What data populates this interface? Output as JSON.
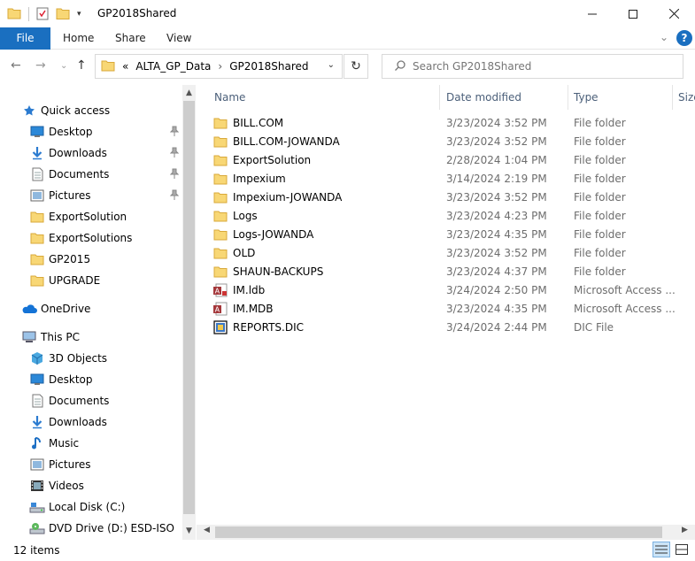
{
  "window": {
    "title": "GP2018Shared"
  },
  "ribbon": {
    "file": "File",
    "home": "Home",
    "share": "Share",
    "view": "View"
  },
  "address": {
    "overflow": "«",
    "crumbs": [
      "ALTA_GP_Data",
      "GP2018Shared"
    ],
    "search_placeholder": "Search GP2018Shared"
  },
  "sidebar": {
    "items": [
      {
        "label": "Quick access",
        "icon": "star-icon",
        "level": 0,
        "pinned": false
      },
      {
        "label": "Desktop",
        "icon": "desktop-icon",
        "level": 1,
        "pinned": true
      },
      {
        "label": "Downloads",
        "icon": "download-icon",
        "level": 1,
        "pinned": true
      },
      {
        "label": "Documents",
        "icon": "document-icon",
        "level": 1,
        "pinned": true
      },
      {
        "label": "Pictures",
        "icon": "pictures-icon",
        "level": 1,
        "pinned": true
      },
      {
        "label": "ExportSolution",
        "icon": "folder-icon",
        "level": 1,
        "pinned": false
      },
      {
        "label": "ExportSolutions",
        "icon": "folder-icon",
        "level": 1,
        "pinned": false
      },
      {
        "label": "GP2015",
        "icon": "folder-icon",
        "level": 1,
        "pinned": false
      },
      {
        "label": "UPGRADE",
        "icon": "folder-icon",
        "level": 1,
        "pinned": false
      },
      {
        "label": "OneDrive",
        "icon": "cloud-icon",
        "level": 0,
        "pinned": false
      },
      {
        "label": "This PC",
        "icon": "computer-icon",
        "level": 0,
        "pinned": false
      },
      {
        "label": "3D Objects",
        "icon": "cube-icon",
        "level": 1,
        "pinned": false
      },
      {
        "label": "Desktop",
        "icon": "desktop-icon",
        "level": 1,
        "pinned": false
      },
      {
        "label": "Documents",
        "icon": "document-icon",
        "level": 1,
        "pinned": false
      },
      {
        "label": "Downloads",
        "icon": "download-icon",
        "level": 1,
        "pinned": false
      },
      {
        "label": "Music",
        "icon": "music-icon",
        "level": 1,
        "pinned": false
      },
      {
        "label": "Pictures",
        "icon": "pictures-icon",
        "level": 1,
        "pinned": false
      },
      {
        "label": "Videos",
        "icon": "video-icon",
        "level": 1,
        "pinned": false
      },
      {
        "label": "Local Disk (C:)",
        "icon": "disk-icon",
        "level": 1,
        "pinned": false
      },
      {
        "label": "DVD Drive (D:) ESD-ISO",
        "icon": "dvd-icon",
        "level": 1,
        "pinned": false
      }
    ]
  },
  "columns": {
    "name": "Name",
    "date": "Date modified",
    "type": "Type",
    "size": "Size"
  },
  "files": [
    {
      "name": "BILL.COM",
      "date": "3/23/2024 3:52 PM",
      "type": "File folder",
      "icon": "folder-icon"
    },
    {
      "name": "BILL.COM-JOWANDA",
      "date": "3/23/2024 3:52 PM",
      "type": "File folder",
      "icon": "folder-icon"
    },
    {
      "name": "ExportSolution",
      "date": "2/28/2024 1:04 PM",
      "type": "File folder",
      "icon": "folder-icon"
    },
    {
      "name": "Impexium",
      "date": "3/14/2024 2:19 PM",
      "type": "File folder",
      "icon": "folder-icon"
    },
    {
      "name": "Impexium-JOWANDA",
      "date": "3/23/2024 3:52 PM",
      "type": "File folder",
      "icon": "folder-icon"
    },
    {
      "name": "Logs",
      "date": "3/23/2024 4:23 PM",
      "type": "File folder",
      "icon": "folder-icon"
    },
    {
      "name": "Logs-JOWANDA",
      "date": "3/23/2024 4:35 PM",
      "type": "File folder",
      "icon": "folder-icon"
    },
    {
      "name": "OLD",
      "date": "3/23/2024 3:52 PM",
      "type": "File folder",
      "icon": "folder-icon"
    },
    {
      "name": "SHAUN-BACKUPS",
      "date": "3/23/2024 4:37 PM",
      "type": "File folder",
      "icon": "folder-icon"
    },
    {
      "name": "IM.ldb",
      "date": "3/24/2024 2:50 PM",
      "type": "Microsoft Access ...",
      "icon": "access-lock-icon"
    },
    {
      "name": "IM.MDB",
      "date": "3/23/2024 4:35 PM",
      "type": "Microsoft Access ...",
      "icon": "access-db-icon"
    },
    {
      "name": "REPORTS.DIC",
      "date": "3/24/2024 2:44 PM",
      "type": "DIC File",
      "icon": "dic-file-icon"
    }
  ],
  "status": {
    "count": "12 items"
  },
  "colors": {
    "accent": "#1a6fc0",
    "folder": "#f8d775",
    "header_text": "#4c607a"
  }
}
